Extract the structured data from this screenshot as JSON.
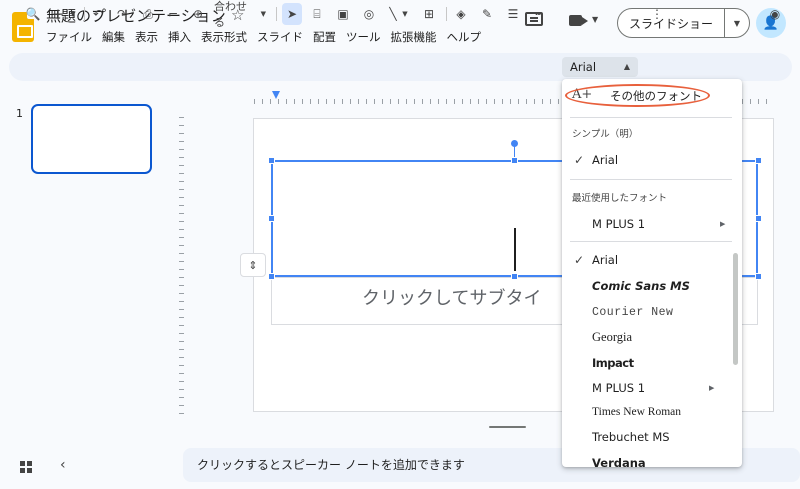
{
  "header": {
    "doc_title": "無題のプレゼンテーション",
    "menu": [
      "ファイル",
      "編集",
      "表示",
      "挿入",
      "表示形式",
      "スライド",
      "配置",
      "ツール",
      "拡張機能",
      "ヘルプ"
    ],
    "slideshow_label": "スライドショー"
  },
  "toolbar": {
    "zoom_label": "合わせる",
    "font_name": "Arial"
  },
  "filmstrip": {
    "slide_number": "1"
  },
  "canvas": {
    "subtitle_placeholder": "クリックしてサブタイ"
  },
  "notes": {
    "placeholder": "クリックするとスピーカー ノートを追加できます"
  },
  "font_menu": {
    "more_fonts": "その他のフォント",
    "section_simple": "シンプル（明）",
    "simple_items": [
      {
        "label": "Arial",
        "checked": true
      }
    ],
    "section_recent": "最近使用したフォント",
    "recent_items": [
      {
        "label": "M PLUS 1",
        "submenu": true
      }
    ],
    "all_items": [
      {
        "label": "Arial",
        "checked": true
      },
      {
        "label": "Comic Sans MS"
      },
      {
        "label": "Courier New"
      },
      {
        "label": "Georgia"
      },
      {
        "label": "Impact"
      },
      {
        "label": "M PLUS 1",
        "submenu": true
      },
      {
        "label": "Times New Roman"
      },
      {
        "label": "Trebuchet MS"
      },
      {
        "label": "Verdana"
      }
    ]
  },
  "colors": {
    "accent": "#4285f4",
    "highlight": "#e8603c",
    "logo": "#f4b400"
  }
}
